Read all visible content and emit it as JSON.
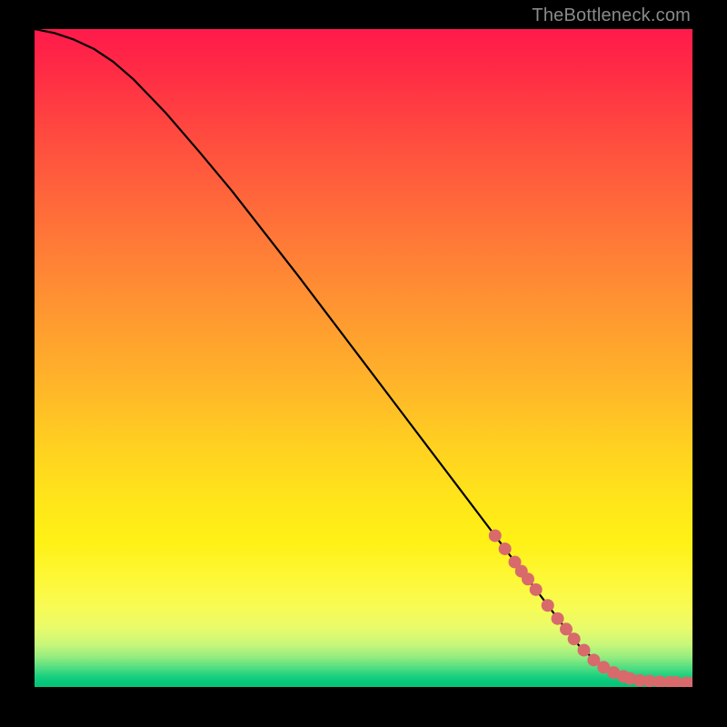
{
  "watermark": "TheBottleneck.com",
  "chart_data": {
    "type": "line",
    "title": "",
    "xlabel": "",
    "ylabel": "",
    "xlim": [
      0,
      100
    ],
    "ylim": [
      0,
      100
    ],
    "grid": false,
    "legend": false,
    "series": [
      {
        "name": "curve",
        "style": "line",
        "color": "#000000",
        "x": [
          0,
          3,
          6,
          9,
          12,
          15,
          20,
          25,
          30,
          35,
          40,
          45,
          50,
          55,
          60,
          65,
          70,
          75,
          80,
          83,
          86,
          89,
          92,
          95,
          98,
          100
        ],
        "y": [
          100,
          99.4,
          98.4,
          97.0,
          95.0,
          92.4,
          87.2,
          81.4,
          75.4,
          69.0,
          62.6,
          56.0,
          49.4,
          42.8,
          36.2,
          29.6,
          23.0,
          16.4,
          9.8,
          6.0,
          3.4,
          1.8,
          1.0,
          0.7,
          0.6,
          0.6
        ]
      },
      {
        "name": "highlight-points",
        "style": "scatter",
        "color": "#d86a6c",
        "x": [
          70.0,
          71.5,
          73.0,
          74.0,
          75.0,
          76.2,
          78.0,
          79.5,
          80.8,
          82.0,
          83.5,
          85.0,
          86.5,
          88.0,
          89.5,
          90.5,
          92.0,
          93.5,
          95.0,
          96.5,
          97.5,
          99.0,
          100.0
        ],
        "y": [
          23.0,
          21.0,
          19.0,
          17.6,
          16.4,
          14.8,
          12.4,
          10.4,
          8.8,
          7.3,
          5.6,
          4.1,
          3.0,
          2.2,
          1.6,
          1.3,
          1.0,
          0.9,
          0.8,
          0.7,
          0.7,
          0.6,
          0.6
        ]
      }
    ]
  }
}
